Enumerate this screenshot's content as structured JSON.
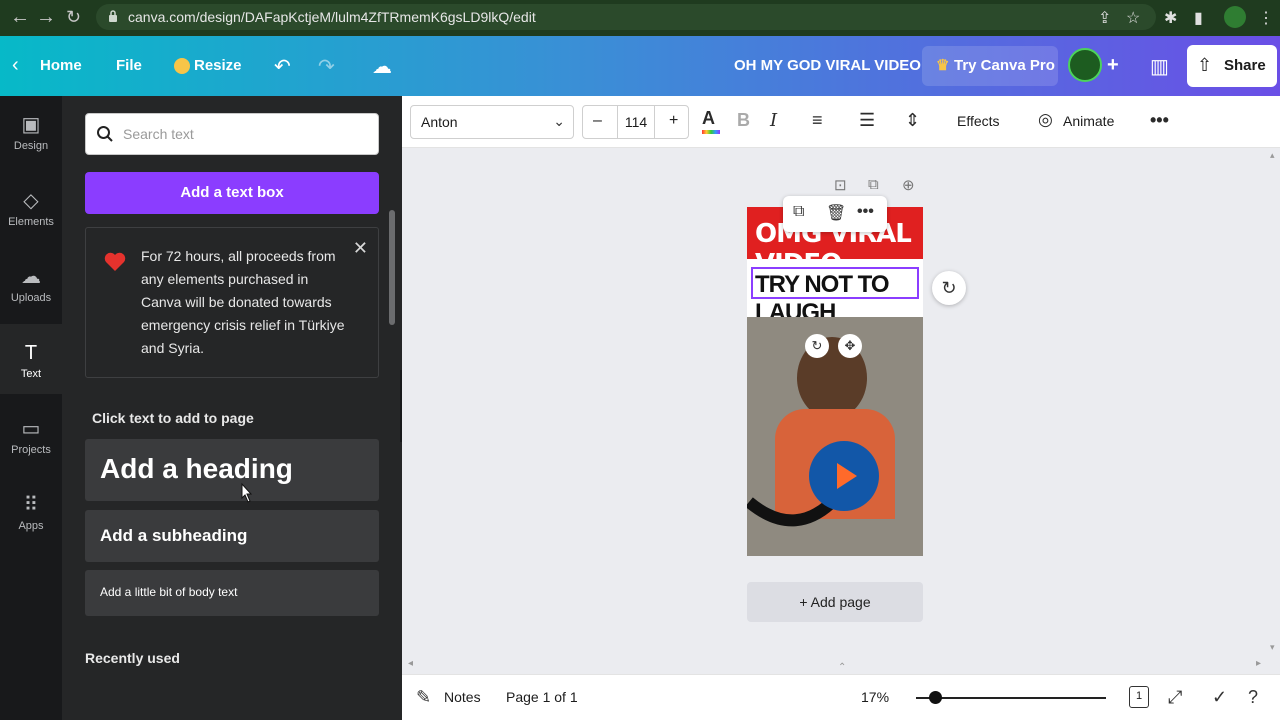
{
  "browser": {
    "url": "canva.com/design/DAFapKctjeM/lulm4ZfTRmemK6gsLD9lkQ/edit"
  },
  "topbar": {
    "home_label": "Home",
    "file_label": "File",
    "resize_label": "Resize",
    "project_title": "OH MY GOD VIRAL VIDEO",
    "try_pro_label": "Try Canva Pro",
    "share_label": "Share",
    "plus_label": "+"
  },
  "rail": {
    "items": [
      {
        "label": "Design",
        "icon": "design-icon"
      },
      {
        "label": "Elements",
        "icon": "elements-icon"
      },
      {
        "label": "Uploads",
        "icon": "uploads-icon"
      },
      {
        "label": "Text",
        "icon": "text-icon"
      },
      {
        "label": "Projects",
        "icon": "projects-icon"
      },
      {
        "label": "Apps",
        "icon": "apps-icon"
      }
    ],
    "active": "Text"
  },
  "panel": {
    "search_placeholder": "Search text",
    "add_text_box": "Add a text box",
    "notice": "For 72 hours, all proceeds from any elements purchased in Canva will be donated towards emergency crisis relief in Türkiye and Syria.",
    "section_title": "Click text to add to page",
    "heading": "Add a heading",
    "subheading": "Add a subheading",
    "body": "Add a little bit of body text",
    "recent_title": "Recently used"
  },
  "toolbar": {
    "font_name": "Anton",
    "font_size": "114",
    "minus": "–",
    "plus": "+",
    "effects_label": "Effects",
    "animate_label": "Animate",
    "accent_color": "#8b3dff"
  },
  "design": {
    "title_text": "OMG VIRAL VIDEO",
    "heading_text": "TRY NOT TO LAUGH",
    "add_page_label": "+ Add page"
  },
  "statusbar": {
    "notes_label": "Notes",
    "page_label": "Page 1 of 1",
    "zoom_label": "17%",
    "zoom_fraction": 0.1,
    "page_count_badge": "1"
  }
}
